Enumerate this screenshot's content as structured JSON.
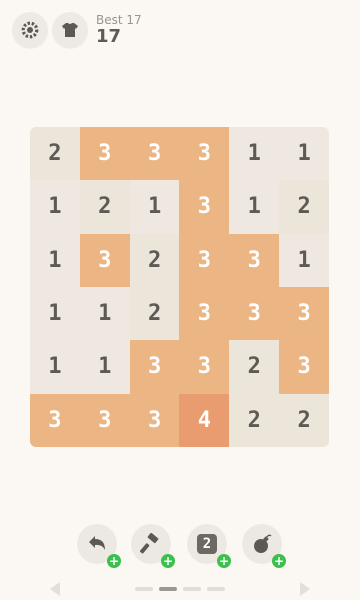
{
  "header": {
    "best_label": "Best 17",
    "score": "17",
    "icons": [
      "gear-icon",
      "shirt-icon"
    ]
  },
  "board": {
    "rows": [
      [
        2,
        3,
        3,
        3,
        1,
        1
      ],
      [
        1,
        2,
        1,
        3,
        1,
        2
      ],
      [
        1,
        3,
        2,
        3,
        3,
        1
      ],
      [
        1,
        1,
        2,
        3,
        3,
        3
      ],
      [
        1,
        1,
        3,
        3,
        2,
        3
      ],
      [
        3,
        3,
        3,
        4,
        2,
        2
      ]
    ],
    "colors": {
      "1": "#eee8e1",
      "2": "#ece5d9",
      "3": "#ecb584",
      "4": "#e89c6f"
    }
  },
  "tools": {
    "two_badge": "2",
    "plus": "+",
    "icons": [
      "undo-icon",
      "hammer-icon",
      "number-two-icon",
      "bomb-icon"
    ]
  },
  "pager": {
    "pages": 4,
    "active_page": 2
  }
}
